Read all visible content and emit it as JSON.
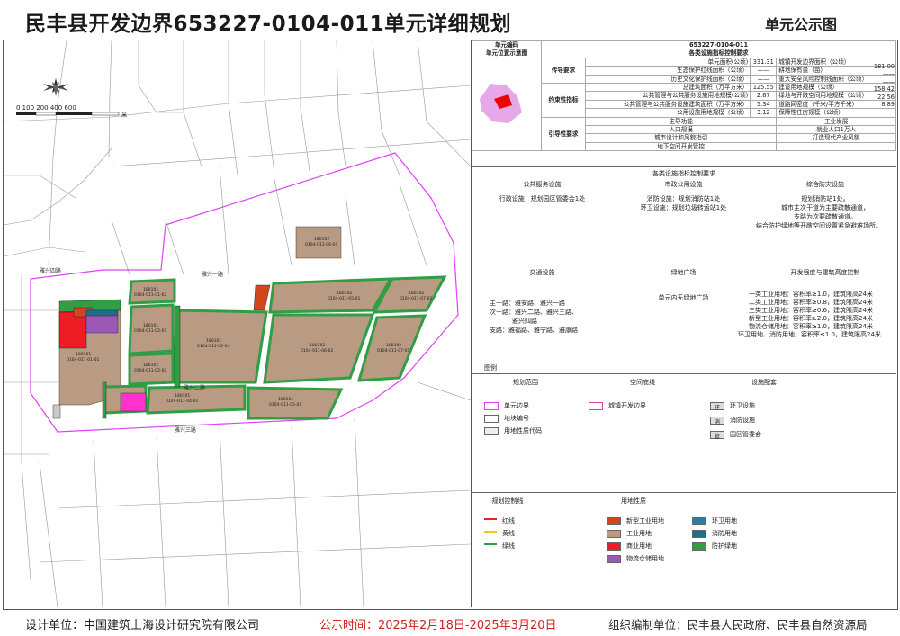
{
  "title": "民丰县开发边界653227-0104-011单元详细规划",
  "subtitle": "单元公示图",
  "map": {
    "scale_label": "0 100 200 400 600",
    "scale_unit": "米",
    "roads": [
      "雅兴一路",
      "雅兴二路",
      "雅兴三路",
      "雅兴四路",
      "雅福路",
      "雅宁路",
      "雅康路"
    ],
    "parcels": [
      {
        "code": "180101",
        "sub": "0104-011-01-01"
      },
      {
        "code": "180101",
        "sub": "0104-011-01-02"
      },
      {
        "code": "180101",
        "sub": "0104-011-02-01"
      },
      {
        "code": "180101",
        "sub": "0104-011-02-02"
      },
      {
        "code": "180101",
        "sub": "0104-011-02-04"
      },
      {
        "code": "180102",
        "sub": "0104-011-06-01"
      },
      {
        "code": "180102",
        "sub": "0104-011-06-02"
      },
      {
        "code": "180102",
        "sub": "0104-011-07-01"
      },
      {
        "code": "180102",
        "sub": "0104-011-07-02"
      },
      {
        "code": "180101",
        "sub": "0104-011-07"
      },
      {
        "code": "180101",
        "sub": "0104-011-04-01"
      },
      {
        "code": "180101",
        "sub": "0104-011-05-01"
      },
      {
        "code": "180102",
        "sub": "0104-011-05-01"
      },
      {
        "code": "180101",
        "sub": "0104-011-03-01"
      }
    ]
  },
  "panel": {
    "unit_code_label": "单元编码",
    "unit_code": "653227-0104-011",
    "location_label": "单元位置示意图",
    "indicators_title": "各类设施指标控制要求",
    "groups": {
      "transmit": "传导要求",
      "constraint": "约束性指标",
      "guide": "引导性要求"
    },
    "rows": [
      [
        "单元面积(公顷)",
        "331.31",
        "城镇开发边界面积（公顷）",
        "181.00"
      ],
      [
        "生态保护红线面积（公顷）",
        "——",
        "耕地保有量（亩）",
        "——"
      ],
      [
        "历史文化保护线面积（公顷）",
        "——",
        "重大安全风险控制线面积（公顷）",
        "——"
      ],
      [
        "总建筑面积（万平方米）",
        "125.55",
        "建设用地规模（公顷）",
        "158.42"
      ],
      [
        "公共管理与公共服务设施用地规模(公顷)",
        "2.67",
        "绿地与开敞空间用地规模（公顷）",
        "22.56"
      ],
      [
        "公共管理与公共服务设施建筑面积（万平方米）",
        "5.34",
        "道路网密度（千米/平方千米）",
        "8.89"
      ],
      [
        "公用设施用地规模（公顷）",
        "3.12",
        "保障性住房规模（公顷）",
        "——"
      ]
    ],
    "guide_rows": [
      [
        "主导功能",
        "工业发展"
      ],
      [
        "人口规模",
        "就业人口1万人"
      ],
      [
        "城市设计和风貌指引",
        "打造现代产业风貌"
      ],
      [
        "地下空间开发管控",
        ""
      ]
    ],
    "facility_title": "各类设施指标控制要求",
    "facility_heads": [
      "公共服务设施",
      "市政公用设施",
      "综合防灾设施"
    ],
    "public_service": "行政设施：规划园区管委会1处",
    "municipal": [
      "消防设施：规划消防站1处",
      "环卫设施：规划垃圾转运站1处"
    ],
    "disaster": [
      "规划消防站1处。",
      "城市主次干道为主要疏散通道，",
      "支路为次要疏散通道。",
      "结合防护绿地等开敞空间设置紧急避难场所。"
    ],
    "facility_heads2": [
      "交通设施",
      "绿地广场",
      "开发强度与建筑高度控制"
    ],
    "traffic": [
      "主干路：雅安路、雅兴一路",
      "次干路：雅兴二路、雅兴三路、",
      "雅兴四路",
      "支路：雅福路、雅宁路、雅康路"
    ],
    "green": "单元内无绿地广场",
    "intensity": [
      "一类工业用地：容积率≥1.0，建筑限高24米",
      "二类工业用地：容积率≥0.8，建筑限高24米",
      "三类工业用地：容积率≥0.6，建筑限高24米",
      "新型工业用地：容积率≥2.0，建筑限高24米",
      "物流仓储用地：容积率≥1.0，建筑限高24米",
      "环卫用地、消防用地：容积率≤1.0，建筑限高24米"
    ],
    "legend_title": "图例",
    "legend_heads": [
      "规划范围",
      "空间底线",
      "设施配套"
    ],
    "legend_scope": [
      "单元边界",
      "地块编号",
      "用地性质代码"
    ],
    "legend_line": "城镇开发边界",
    "legend_facility": [
      "环卫设施",
      "消防设施",
      "园区管委会"
    ],
    "legend_facility_codes": [
      "环",
      "消",
      "管"
    ],
    "legend_heads2": [
      "规划控制线",
      "用地性质"
    ],
    "control_lines": [
      "红线",
      "黄线",
      "绿线"
    ],
    "land_use": [
      "新型工业用地",
      "工业用地",
      "商业用地",
      "物流仓储用地"
    ],
    "land_use2": [
      "环卫用地",
      "消防用地",
      "防护绿地"
    ],
    "colors": {
      "industrial": "#b89b82",
      "new_industrial": "#d2451e",
      "commercial": "#ee1c24",
      "logistics": "#9b59b6",
      "green": "#2f9e44",
      "boundary": "#e040fb",
      "admin": "#ff33cc",
      "env": "#2b7da1",
      "fire": "#1f6f8b"
    }
  },
  "footer": {
    "designer": "设计单位：中国建筑上海设计研究院有限公司",
    "period": "公示时间：2025年2月18日-2025年3月20日",
    "organizer": "组织编制单位：民丰县人民政府、民丰县自然资源局"
  }
}
